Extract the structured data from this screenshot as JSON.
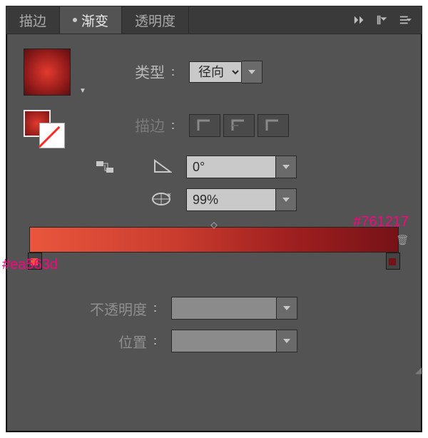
{
  "tabs": {
    "stroke": "描边",
    "gradient": "渐变",
    "transparency": "透明度"
  },
  "labels": {
    "type": "类型",
    "stroke": "描边",
    "angle": "角度",
    "ratio": "长宽比",
    "opacity": "不透明度",
    "position": "位置",
    "colon": "："
  },
  "values": {
    "type": "径向",
    "angle": "0°",
    "ratio": "99%",
    "opacity": "",
    "position": ""
  },
  "gradient": {
    "start": "#ea563d",
    "end": "#761217"
  },
  "annotations": {
    "right": "#761217",
    "left": "#ea563d"
  }
}
